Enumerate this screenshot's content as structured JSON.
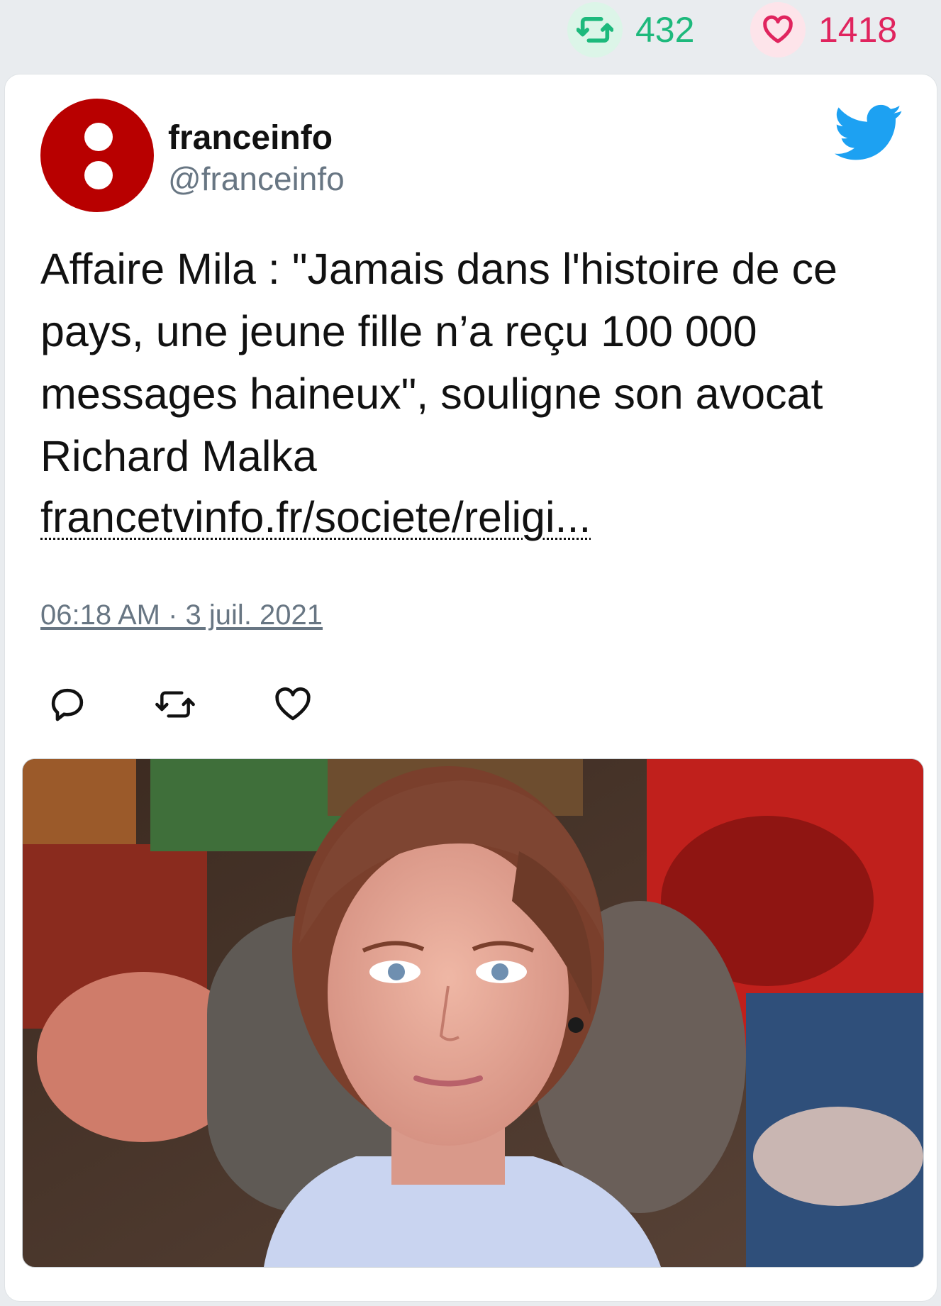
{
  "stats": {
    "retweets": "432",
    "likes": "1418",
    "retweet_color": "#1db97c",
    "like_color": "#e0245e"
  },
  "tweet": {
    "author_name": "franceinfo",
    "author_handle": "@franceinfo",
    "avatar_color": "#b80000",
    "text": "Affaire Mila : \"Jamais dans l'histoire de ce pays, une jeune fille n’a reçu 100 000 messages haineux\", souligne son avocat Richard Malka",
    "link": "francetvinfo.fr/societe/religi...",
    "timestamp": "06:18 AM · 3 juil. 2021"
  },
  "icons": {
    "platform": "twitter-bird-icon",
    "reply": "reply-icon",
    "retweet": "retweet-icon",
    "like": "heart-icon"
  },
  "media": {
    "description_icon": "photo-thumbnail"
  }
}
